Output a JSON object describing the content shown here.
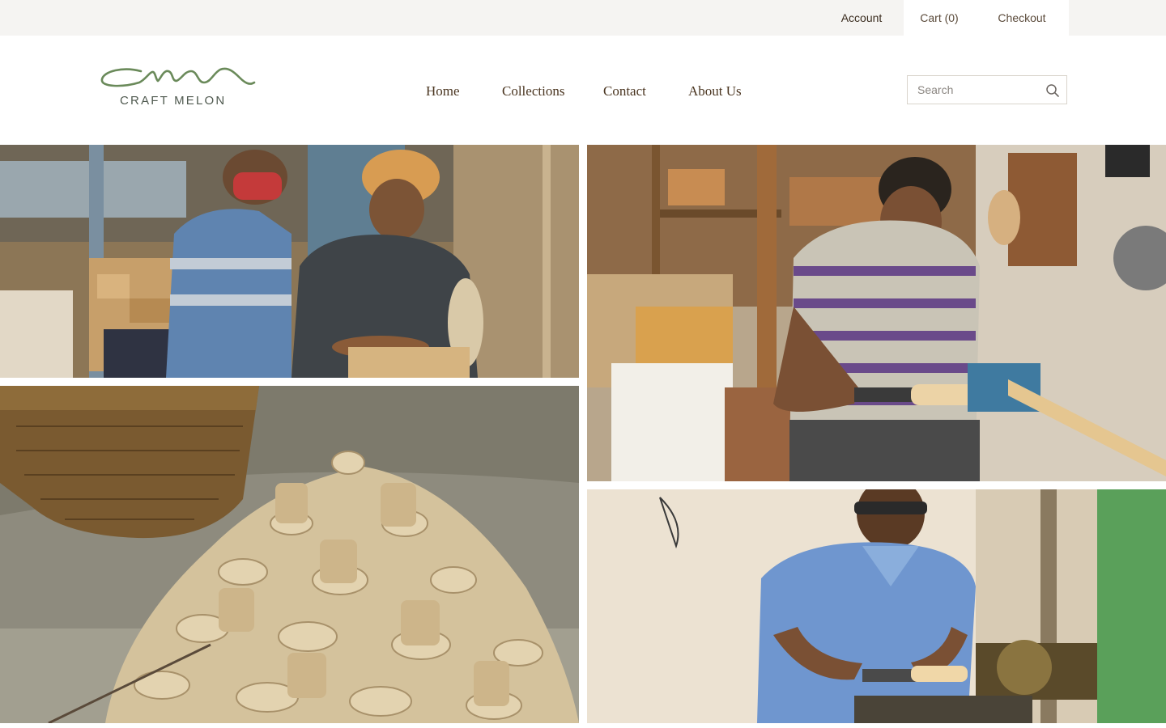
{
  "topbar": {
    "account_label": "Account",
    "cart_label": "Cart (0)",
    "checkout_label": "Checkout"
  },
  "brand": {
    "name": "CRAFT MELON",
    "logo_color": "#6a8a5a"
  },
  "nav": {
    "items": [
      {
        "label": "Home"
      },
      {
        "label": "Collections"
      },
      {
        "label": "Contact"
      },
      {
        "label": "About Us"
      }
    ]
  },
  "search": {
    "placeholder": "Search",
    "value": ""
  },
  "icons": {
    "search": "search-icon"
  },
  "gallery": {
    "photos": [
      {
        "name": "artisans-sanding-wood-photo"
      },
      {
        "name": "artisan-turning-lathe-photo"
      },
      {
        "name": "wooden-chess-pieces-pile-photo"
      },
      {
        "name": "artisan-carving-on-lathe-photo"
      }
    ]
  }
}
